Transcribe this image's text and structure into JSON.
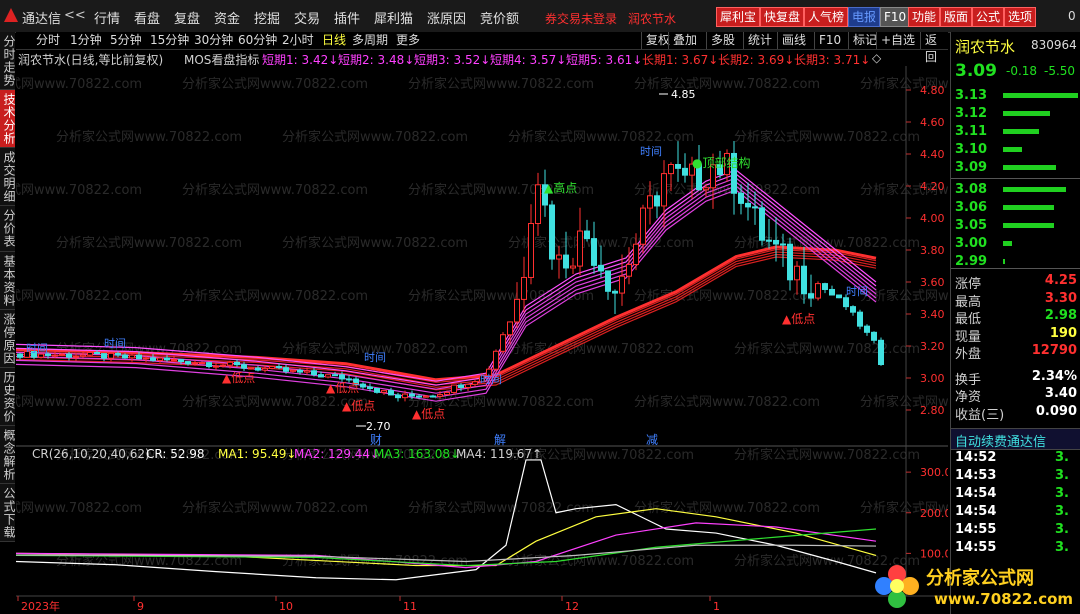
{
  "app": {
    "name": "通达信",
    "back": "<<"
  },
  "menu": [
    "行情",
    "看盘",
    "复盘",
    "资金",
    "挖掘",
    "交易",
    "插件",
    "犀利猫",
    "涨原因",
    "竞价额"
  ],
  "notice": {
    "login": "券交易未登录",
    "stock": "润农节水"
  },
  "toolbar_buttons": [
    "犀利宝",
    "快复盘",
    "人气榜",
    "电报",
    "F10",
    "功能",
    "版面",
    "公式",
    "选项"
  ],
  "corner_text": "0",
  "periods": [
    "分时",
    "1分钟",
    "5分钟",
    "15分钟",
    "30分钟",
    "60分钟",
    "2小时",
    "日线",
    "多周期",
    "更多"
  ],
  "active_period": "日线",
  "tools": [
    "复权",
    "叠加",
    "多股",
    "统计",
    "画线",
    "F10",
    "标记",
    "+自选",
    "返回"
  ],
  "chart_header": {
    "title": "润农节水(日线,等比前复权)",
    "indicator": "MOS看盘指标",
    "short": [
      {
        "t": "短期1: 3.42↓"
      },
      {
        "t": "短期2: 3.48↓"
      },
      {
        "t": "短期3: 3.52↓"
      },
      {
        "t": "短期4: 3.57↓"
      },
      {
        "t": "短期5: 3.61↓"
      }
    ],
    "long": [
      {
        "t": "长期1: 3.67↓"
      },
      {
        "t": "长期2: 3.69↓"
      },
      {
        "t": "长期3: 3.71↓"
      }
    ]
  },
  "left_tabs": [
    "分时走势",
    "技术分析",
    "成交明细",
    "分价表",
    "基本资料",
    "涨停原因",
    "历史资价",
    "概念解析",
    "公式下载"
  ],
  "active_left_tab": "技术分析",
  "stock": {
    "name": "润农节水",
    "code": "830964",
    "price": "3.09",
    "change": "-0.18",
    "pct": "-5.50"
  },
  "orderbook": [
    {
      "p": "3.13",
      "v": 88,
      "side": "sell"
    },
    {
      "p": "3.12",
      "v": 55,
      "side": "sell"
    },
    {
      "p": "3.11",
      "v": 42,
      "side": "sell"
    },
    {
      "p": "3.10",
      "v": 22,
      "side": "sell"
    },
    {
      "p": "3.09",
      "v": 62,
      "side": "sell"
    },
    {
      "p": "3.08",
      "v": 74,
      "side": "buy"
    },
    {
      "p": "3.06",
      "v": 60,
      "side": "buy"
    },
    {
      "p": "3.05",
      "v": 60,
      "side": "buy"
    },
    {
      "p": "3.00",
      "v": 10,
      "side": "buy"
    },
    {
      "p": "2.99",
      "v": 2,
      "side": "buy"
    }
  ],
  "stats": [
    {
      "k": "涨停",
      "v": "4.25",
      "c": "red"
    },
    {
      "k": "最高",
      "v": "3.30",
      "c": "red"
    },
    {
      "k": "最低",
      "v": "2.98",
      "c": "green"
    },
    {
      "k": "现量",
      "v": "190",
      "c": "yellow"
    },
    {
      "k": "外盘",
      "v": "12790",
      "c": "red"
    },
    {
      "k": "换手",
      "v": "2.34%",
      "c": "white"
    },
    {
      "k": "净资",
      "v": "3.40",
      "c": "white"
    },
    {
      "k": "收益(三)",
      "v": "0.090",
      "c": "white"
    }
  ],
  "banner": "自动续费通达信",
  "ticks": [
    {
      "t": "14:52",
      "p": "3."
    },
    {
      "t": "14:53",
      "p": "3."
    },
    {
      "t": "14:54",
      "p": "3."
    },
    {
      "t": "14:54",
      "p": "3."
    },
    {
      "t": "14:55",
      "p": "3."
    },
    {
      "t": "14:55",
      "p": "3."
    }
  ],
  "price_axis": [
    "4.80",
    "4.60",
    "4.40",
    "4.20",
    "4.00",
    "3.80",
    "3.60",
    "3.40",
    "3.20",
    "3.00",
    "2.80"
  ],
  "annotations": {
    "high_label": "4.85",
    "low_label": "2.70",
    "gaodian": "▲高点",
    "dingbu": "●顶部结构",
    "didian": "▲低点",
    "shijian": "时间",
    "cai": "财",
    "jie": "解",
    "jian": "减"
  },
  "cr_header": {
    "name": "CR(26,10,20,40,62)",
    "cr": "CR: 52.98",
    "ma1": "MA1: 95.49↓",
    "ma2": "MA2: 129.44↓",
    "ma3": "MA3: 163.08↓",
    "ma4": "MA4: 119.67↑"
  },
  "cr_axis": [
    "300.0",
    "200.0",
    "100.0"
  ],
  "time_axis": [
    "2023年",
    "9",
    "10",
    "11",
    "12",
    "1"
  ],
  "watermark": "分析家公式网www.70822.com",
  "logo": {
    "text": "分析家公式网",
    "url": "www.70822.com"
  },
  "colors": {
    "up": "#ff3030",
    "down": "#40e0e0",
    "short_ma": "#ff40ff",
    "long_ma": "#ff2020"
  }
}
